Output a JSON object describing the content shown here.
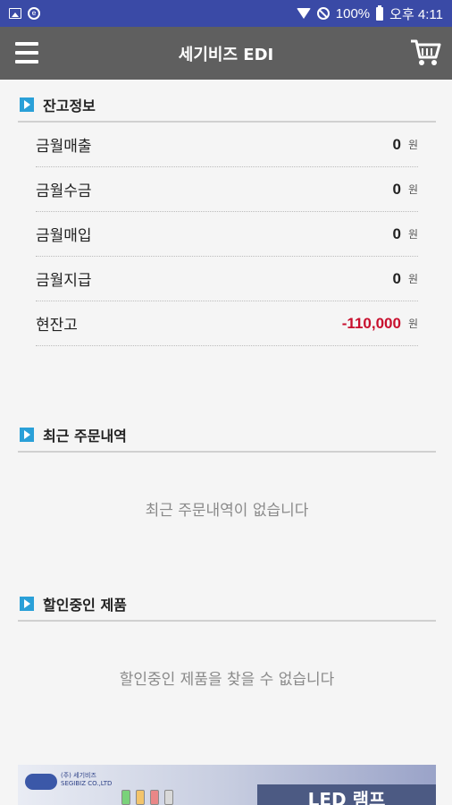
{
  "status_bar": {
    "battery": "100%",
    "time": "오후 4:11"
  },
  "app_bar": {
    "title": "세기비즈 EDI"
  },
  "balance_section": {
    "title": "잔고정보",
    "unit": "원",
    "rows": [
      {
        "label": "금월매출",
        "value": "0"
      },
      {
        "label": "금월수금",
        "value": "0"
      },
      {
        "label": "금월매입",
        "value": "0"
      },
      {
        "label": "금월지급",
        "value": "0"
      },
      {
        "label": "현잔고",
        "value": "-110,000"
      }
    ],
    "negative_color": "#c8102e"
  },
  "orders_section": {
    "title": "최근 주문내역",
    "empty_message": "최근 주문내역이 없습니다"
  },
  "sale_section": {
    "title": "할인중인 제품",
    "empty_message": "할인중인 제품을 찾을 수 없습니다"
  },
  "banner": {
    "company": "(주) 세기비즈",
    "company_en": "SEGIBIZ CO.,LTD",
    "headline": "LED 램프"
  },
  "colors": {
    "status_bar": "#3a4aa6",
    "app_bar": "#5f5f5f",
    "section_icon": "#2aa0d8"
  }
}
